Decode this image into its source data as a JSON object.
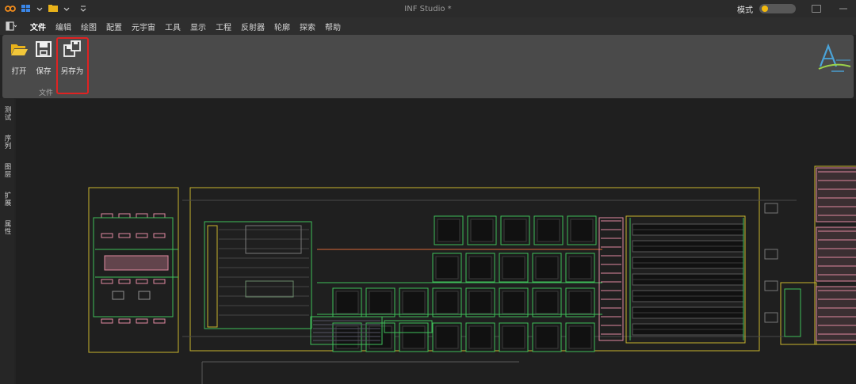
{
  "window": {
    "title": "INF Studio *",
    "mode_label": "模式"
  },
  "menu": {
    "items": [
      "文件",
      "编辑",
      "绘图",
      "配置",
      "元宇宙",
      "工具",
      "显示",
      "工程",
      "反射器",
      "轮廓",
      "探索",
      "帮助"
    ],
    "active_index": 0
  },
  "ribbon": {
    "buttons": [
      {
        "label": "打开",
        "icon": "folder-open-icon"
      },
      {
        "label": "保存",
        "icon": "save-icon"
      },
      {
        "label": "另存为",
        "icon": "save-as-icon"
      }
    ],
    "group_label": "文件"
  },
  "sidebar": {
    "items": [
      "测试",
      "序列",
      "图层",
      "扩展",
      "属性"
    ]
  },
  "colors": {
    "accent": "#3d7be0",
    "highlight": "#e02222",
    "toggle_knob": "#f2b90f",
    "layout_yellow": "#c9b52e",
    "layout_green": "#3fbf5a",
    "layout_pink": "#e08aa0"
  }
}
